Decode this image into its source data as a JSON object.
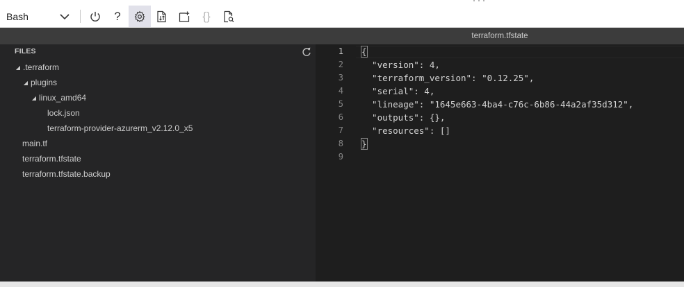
{
  "toolbar": {
    "shell_label": "Bash",
    "help_label": "?",
    "braces_label": "{}"
  },
  "editor": {
    "active_tab": "terraform.tfstate",
    "files_title": "FILES",
    "tree": [
      {
        "label": ".terraform",
        "expanded": true
      },
      {
        "label": "plugins",
        "expanded": true
      },
      {
        "label": "linux_amd64",
        "expanded": true
      },
      {
        "label": "lock.json"
      },
      {
        "label": "terraform-provider-azurerm_v2.12.0_x5"
      },
      {
        "label": "main.tf"
      },
      {
        "label": "terraform.tfstate"
      },
      {
        "label": "terraform.tfstate.backup"
      }
    ],
    "line_numbers": [
      "1",
      "2",
      "3",
      "4",
      "5",
      "6",
      "7",
      "8",
      "9"
    ],
    "code_lines": [
      "{",
      "  \"version\": 4,",
      "  \"terraform_version\": \"0.12.25\",",
      "  \"serial\": 4,",
      "  \"lineage\": \"1645e663-4ba4-c76c-6b86-44a2af35d312\",",
      "  \"outputs\": {},",
      "  \"resources\": []",
      "}",
      ""
    ]
  }
}
